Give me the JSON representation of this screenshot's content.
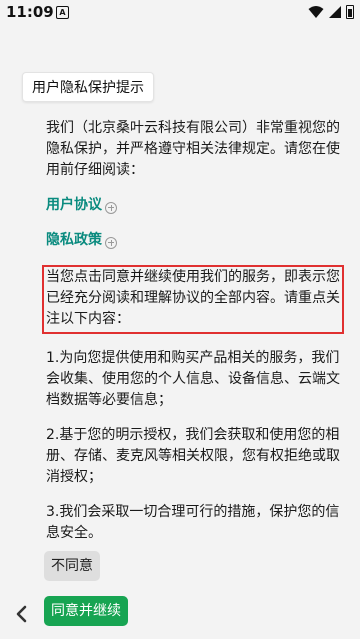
{
  "status_bar": {
    "time": "11:09",
    "notification_icon": "A"
  },
  "dialog": {
    "title": "用户隐私保护提示",
    "intro": "我们（北京桑叶云科技有限公司）非常重视您的隐私保护，并严格遵守相关法律规定。请您在使用前仔细阅读：",
    "links": [
      {
        "label": "用户协议"
      },
      {
        "label": "隐私政策"
      }
    ],
    "highlight_text": "当您点击同意并继续使用我们的服务，即表示您已经充分阅读和理解协议的全部内容。请重点关注以下内容：",
    "points": [
      "1.为向您提供使用和购买产品相关的服务，我们会收集、使用您的个人信息、设备信息、云端文档数据等必要信息；",
      "2.基于您的明示授权，我们会获取和使用您的相册、存储、麦克风等相关权限，您有权拒绝或取消授权；",
      "3.我们会采取一切合理可行的措施，保护您的信息安全。"
    ],
    "disagree_label": "不同意",
    "agree_label": "同意并继续"
  },
  "colors": {
    "link": "#0a8b7f",
    "agree_button": "#17a452",
    "highlight_border": "#e03030"
  }
}
